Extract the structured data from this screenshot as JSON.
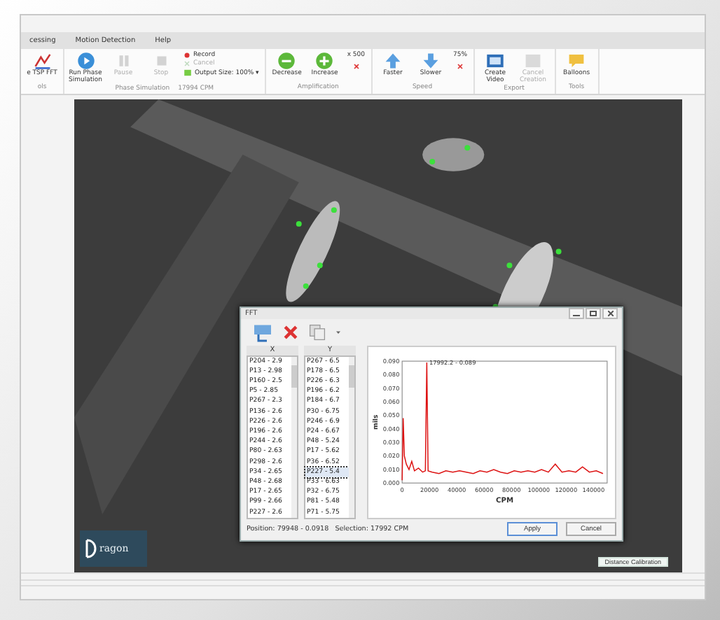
{
  "menu": [
    "cessing",
    "Motion Detection",
    "Help"
  ],
  "ribbon": {
    "groups": [
      {
        "label": "ols",
        "items": [
          {
            "kind": "large",
            "label": "e TSP FFT",
            "disabled": false
          }
        ]
      },
      {
        "label": "Phase Simulation",
        "note": "17994 CPM",
        "items": [
          {
            "kind": "large",
            "label": "Run Phase Simulation",
            "disabled": false
          },
          {
            "kind": "large",
            "label": "Pause",
            "disabled": true
          },
          {
            "kind": "large",
            "label": "Stop",
            "disabled": true
          },
          {
            "kind": "small",
            "label": "Record",
            "disabled": false
          },
          {
            "kind": "small",
            "label": "Cancel",
            "disabled": true
          },
          {
            "kind": "small",
            "label": "Output Size: 100% ▾",
            "disabled": false
          }
        ]
      },
      {
        "label": "Amplification",
        "items": [
          {
            "kind": "large",
            "label": "Decrease",
            "disabled": false
          },
          {
            "kind": "large",
            "label": "Increase",
            "disabled": false
          },
          {
            "kind": "value",
            "label": "x 500",
            "disabled": false
          }
        ]
      },
      {
        "label": "Speed",
        "items": [
          {
            "kind": "large",
            "label": "Faster",
            "disabled": false
          },
          {
            "kind": "large",
            "label": "Slower",
            "disabled": false
          },
          {
            "kind": "value",
            "label": "75%",
            "disabled": false
          }
        ]
      },
      {
        "label": "Export",
        "items": [
          {
            "kind": "large",
            "label": "Create Video",
            "disabled": false
          },
          {
            "kind": "large",
            "label": "Cancel Creation",
            "disabled": true
          }
        ]
      },
      {
        "label": "Tools",
        "items": [
          {
            "kind": "large",
            "label": "Balloons",
            "disabled": false
          }
        ]
      }
    ]
  },
  "video": {
    "logo": "ragon",
    "calibration_button": "Distance Calibration"
  },
  "fft": {
    "title": "FFT",
    "lists": [
      {
        "header": "X",
        "items": [
          {
            "label": "P204 - 2.9",
            "selected": false
          },
          {
            "label": "P13 - 2.98",
            "selected": false
          },
          {
            "label": "P160 - 2.5",
            "selected": false
          },
          {
            "label": "P5 - 2.85",
            "selected": false
          },
          {
            "label": "P267 - 2.3",
            "selected": false
          },
          {
            "label": "P136 - 2.6",
            "selected": false
          },
          {
            "label": "P226 - 2.6",
            "selected": false
          },
          {
            "label": "P196 - 2.6",
            "selected": false
          },
          {
            "label": "P244 - 2.6",
            "selected": false
          },
          {
            "label": "P80 - 2.63",
            "selected": false
          },
          {
            "label": "P298 - 2.6",
            "selected": false
          },
          {
            "label": "P34 - 2.65",
            "selected": false
          },
          {
            "label": "P48 - 2.68",
            "selected": false
          },
          {
            "label": "P17 - 2.65",
            "selected": false
          },
          {
            "label": "P99 - 2.66",
            "selected": false
          },
          {
            "label": "P227 - 2.6",
            "selected": false
          }
        ]
      },
      {
        "header": "Y",
        "items": [
          {
            "label": "P267 - 6.5",
            "selected": false
          },
          {
            "label": "P178 - 6.5",
            "selected": false
          },
          {
            "label": "P226 - 6.3",
            "selected": false
          },
          {
            "label": "P196 - 6.2",
            "selected": false
          },
          {
            "label": "P184 - 6.7",
            "selected": false
          },
          {
            "label": "P30 - 6.75",
            "selected": false
          },
          {
            "label": "P246 - 6.9",
            "selected": false
          },
          {
            "label": "P24 - 6.67",
            "selected": false
          },
          {
            "label": "P48 - 5.24",
            "selected": false
          },
          {
            "label": "P17 - 5.62",
            "selected": false
          },
          {
            "label": "P36 - 6.52",
            "selected": false
          },
          {
            "label": "P227 - 5.4",
            "selected": true
          },
          {
            "label": "P33 - 6.63",
            "selected": false
          },
          {
            "label": "P32 - 6.75",
            "selected": false
          },
          {
            "label": "P81 - 5.48",
            "selected": false
          },
          {
            "label": "P71 - 5.75",
            "selected": false
          }
        ]
      }
    ],
    "chart_data": {
      "type": "line",
      "xlabel": "CPM",
      "ylabel": "mils",
      "xlim": [
        0,
        150000
      ],
      "ylim": [
        0,
        0.09
      ],
      "xticks": [
        0,
        20000,
        40000,
        60000,
        80000,
        100000,
        120000,
        140000
      ],
      "yticks": [
        {
          "value": 0,
          "label": "0.000"
        },
        {
          "value": 0.01,
          "label": "0.010"
        },
        {
          "value": 0.02,
          "label": "0.020"
        },
        {
          "value": 0.03,
          "label": "0.030"
        },
        {
          "value": 0.04,
          "label": "0.040"
        },
        {
          "value": 0.05,
          "label": "0.050"
        },
        {
          "value": 0.06,
          "label": "0.060"
        },
        {
          "value": 0.07,
          "label": "0.070"
        },
        {
          "value": 0.08,
          "label": "0.080"
        },
        {
          "value": 0.09,
          "label": "0.090"
        }
      ],
      "x": [
        0,
        800,
        1600,
        3000,
        5000,
        7000,
        9000,
        12000,
        15000,
        17000,
        17992,
        19000,
        22000,
        27000,
        32000,
        37000,
        42000,
        47000,
        52000,
        57000,
        62000,
        67000,
        72000,
        77000,
        82000,
        87000,
        92000,
        97000,
        102000,
        107000,
        112000,
        117000,
        122000,
        127000,
        132000,
        137000,
        142000,
        147000
      ],
      "series": [
        {
          "color": "#dd1111",
          "values": [
            0.002,
            0.048,
            0.02,
            0.014,
            0.01,
            0.016,
            0.009,
            0.011,
            0.008,
            0.009,
            0.089,
            0.009,
            0.008,
            0.007,
            0.009,
            0.008,
            0.009,
            0.008,
            0.007,
            0.009,
            0.008,
            0.01,
            0.008,
            0.007,
            0.009,
            0.008,
            0.009,
            0.008,
            0.01,
            0.008,
            0.014,
            0.008,
            0.009,
            0.008,
            0.012,
            0.008,
            0.009,
            0.007
          ]
        }
      ],
      "annotations": [
        {
          "text": "17992.2 - 0.089"
        }
      ]
    },
    "status": "Position: 79948 - 0.0918   Selection: 17992 CPM",
    "buttons": [
      {
        "label": "Apply",
        "selected": true
      },
      {
        "label": "Cancel",
        "selected": false
      }
    ]
  }
}
